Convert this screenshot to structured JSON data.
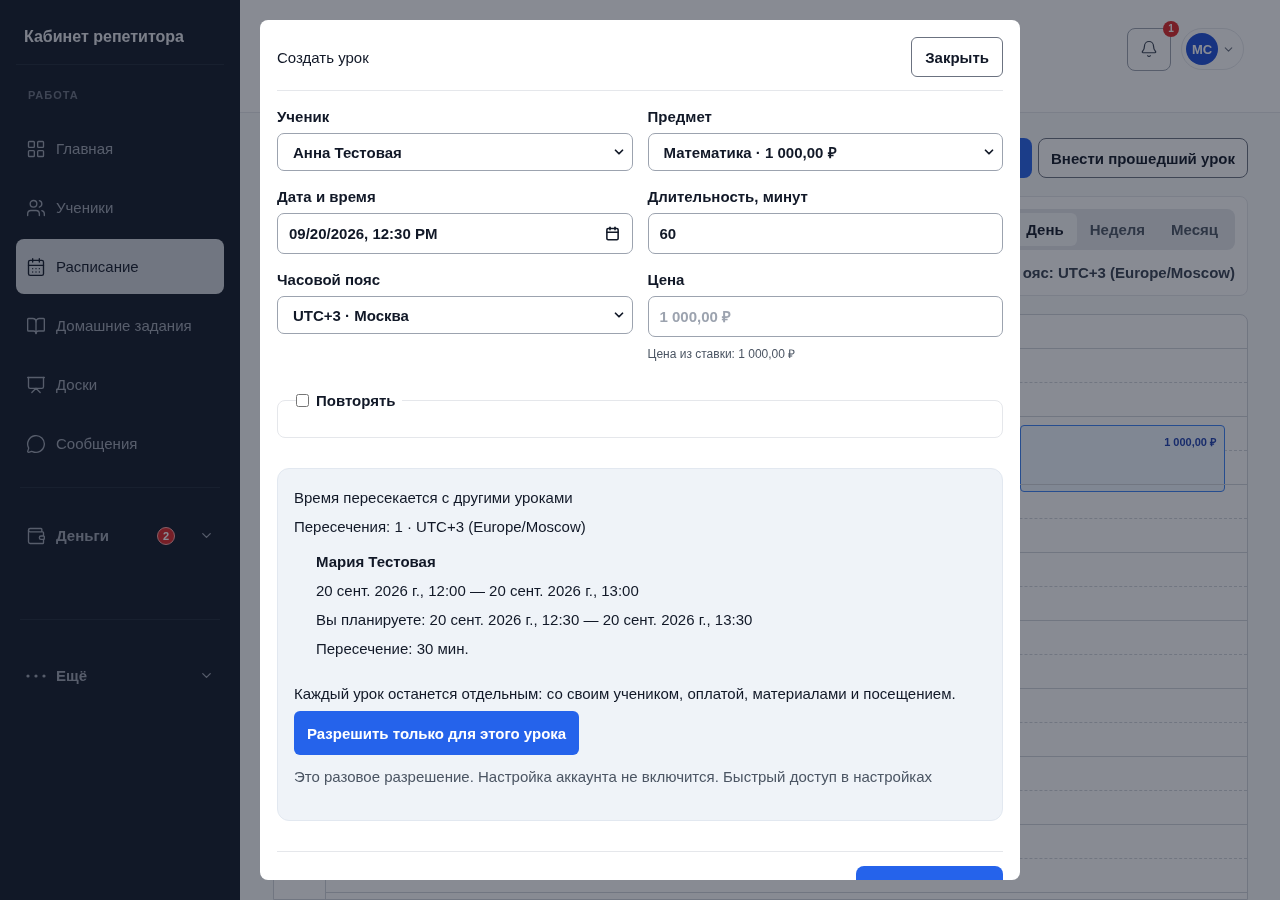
{
  "sidebar": {
    "title": "Кабинет репетитора",
    "section_label": "РАБОТА",
    "items": [
      {
        "label": "Главная",
        "selected": false
      },
      {
        "label": "Ученики",
        "selected": false
      },
      {
        "label": "Расписание",
        "selected": true
      },
      {
        "label": "Домашние задания",
        "selected": false
      },
      {
        "label": "Доски",
        "selected": false
      },
      {
        "label": "Сообщения",
        "selected": false
      }
    ],
    "money": {
      "label": "Деньги",
      "badge": "2",
      "expanded": false
    },
    "more": {
      "label": "Ещё",
      "expanded": false
    }
  },
  "header": {
    "notifications_badge": "1",
    "avatar_initials": "МС"
  },
  "toolbar": {
    "secondary_button": "Внести прошедший урок"
  },
  "view_tabs": [
    {
      "label": "День",
      "selected": true
    },
    {
      "label": "Неделя",
      "selected": false
    },
    {
      "label": "Месяц",
      "selected": false
    }
  ],
  "timezone_note": "ояс: UTC+3 (Europe/Moscow)",
  "calendar": {
    "event_price": "1 000,00 ₽"
  },
  "modal": {
    "title": "Создать урок",
    "close_button": "Закрыть",
    "fields": [
      {
        "kind": "select",
        "label": "Ученик",
        "value": "Анна Тестовая"
      },
      {
        "kind": "select",
        "label": "Предмет",
        "value": "Математика · 1 000,00 ₽"
      },
      {
        "kind": "datetime",
        "label": "Дата и время",
        "value": "09/20/2026, 12:30 PM"
      },
      {
        "kind": "input",
        "label": "Длительность, минут",
        "value": "60"
      },
      {
        "kind": "select",
        "label": "Часовой пояс",
        "value": "UTC+3 · Москва"
      },
      {
        "kind": "input",
        "label": "Цена",
        "placeholder": "1 000,00 ₽",
        "hint": "Цена из ставки: 1 000,00 ₽"
      }
    ],
    "repeat": {
      "label": "Повторять",
      "checked": false
    },
    "conflict": {
      "title": "Время пересекается с другими уроками",
      "summary": "Пересечения: 1 · UTC+3 (Europe/Moscow)",
      "lesson": {
        "student": "Мария Тестовая",
        "time": "20 сент. 2026 г., 12:00 — 20 сент. 2026 г., 13:00",
        "planned": "Вы планируете: 20 сент. 2026 г., 12:30 — 20 сент. 2026 г., 13:30",
        "overlap": "Пересечение: 30 мин."
      },
      "note": "Каждый урок останется отдельным: со своим учеником, оплатой, материалами и посещением.",
      "allow_button": "Разрешить только для этого урока",
      "footnote": "Это разовое разрешение. Настройка аккаунта не включится. Быстрый доступ в настройках"
    }
  }
}
